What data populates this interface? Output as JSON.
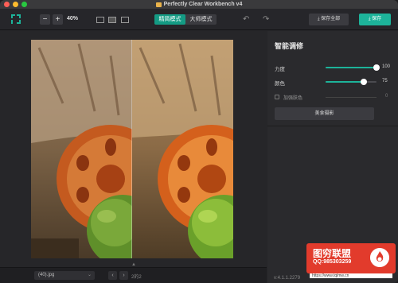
{
  "window": {
    "title": "Perfectly Clear Workbench v4"
  },
  "toolbar": {
    "zoom_out": "−",
    "zoom_in": "+",
    "zoom_level": "40%",
    "modes": [
      "精简模式",
      "大师模式"
    ],
    "active_mode": "精简模式",
    "undo_icon": "undo-icon",
    "redo_icon": "redo-icon",
    "save_all_label": "保存全部",
    "save_label": "保存"
  },
  "panel": {
    "title": "智能调修",
    "sliders": [
      {
        "label": "力度",
        "value": "100",
        "level": 1.0
      },
      {
        "label": "颜色",
        "value": "75",
        "level": 0.75
      }
    ],
    "checkbox": {
      "label": "加强肤色",
      "value": "0",
      "checked": false
    },
    "preset_label": "美食摄影",
    "version": "v:4.1.1.2279"
  },
  "bottom": {
    "file_name": "(40).jpg",
    "page_indicator": "2的2",
    "prev": "‹",
    "next": "›"
  },
  "watermark": {
    "title": "图穷联盟",
    "qq": "QQ:985303259",
    "url": "https://www.tqlmw.cn"
  },
  "colors": {
    "accent": "#1db39a",
    "bg": "#252528",
    "panel": "#2a2a2d",
    "watermark": "#e23b2c"
  }
}
